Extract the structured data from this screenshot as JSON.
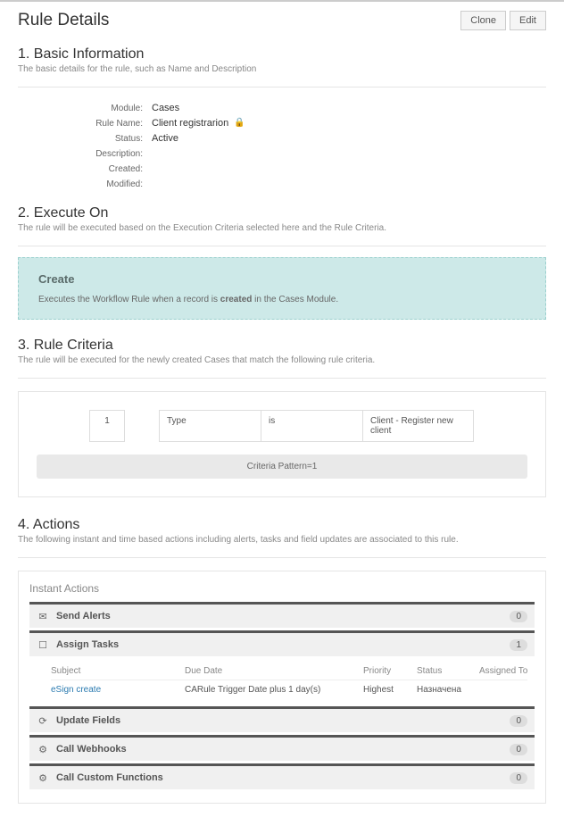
{
  "page": {
    "title": "Rule Details",
    "buttons": {
      "clone": "Clone",
      "edit": "Edit"
    }
  },
  "basic": {
    "heading_num": "1.",
    "heading": "Basic Information",
    "desc": "The basic details for the rule, such as Name and Description",
    "fields": {
      "module_label": "Module:",
      "module_value": "Cases",
      "rulename_label": "Rule Name:",
      "rulename_value": "Client registrarion",
      "status_label": "Status:",
      "status_value": "Active",
      "description_label": "Description:",
      "description_value": "",
      "created_label": "Created:",
      "created_value": " ",
      "modified_label": "Modified:",
      "modified_value": ""
    }
  },
  "execute": {
    "heading_num": "2.",
    "heading": "Execute On",
    "desc": "The rule will be executed based on the Execution Criteria selected here and the Rule Criteria.",
    "box_title": "Create",
    "box_desc_pre": "Executes the Workflow Rule when a record is ",
    "box_desc_bold": "created",
    "box_desc_post": " in the Cases Module."
  },
  "criteria": {
    "heading_num": "3.",
    "heading": "Rule Criteria",
    "desc": "The rule will be executed for the newly created Cases that match the following rule criteria.",
    "row": {
      "num": "1",
      "field": "Type",
      "op": "is",
      "value": "Client - Register new client"
    },
    "pattern": "Criteria Pattern=1"
  },
  "actions": {
    "heading_num": "4.",
    "heading": "Actions",
    "desc": "The following instant and time based actions including alerts, tasks and field updates are associated to this rule.",
    "instant_title": "Instant Actions",
    "groups": {
      "send_alerts": {
        "label": "Send Alerts",
        "count": "0"
      },
      "assign_tasks": {
        "label": "Assign Tasks",
        "count": "1"
      },
      "update_fields": {
        "label": "Update Fields",
        "count": "0"
      },
      "call_webhooks": {
        "label": "Call Webhooks",
        "count": "0"
      },
      "call_custom": {
        "label": "Call Custom Functions",
        "count": "0"
      }
    },
    "task_head": {
      "subject": "Subject",
      "due": "Due Date",
      "priority": "Priority",
      "status": "Status",
      "assigned": "Assigned To"
    },
    "task_row": {
      "subject": "eSign create",
      "due": "CARule Trigger Date plus 1 day(s)",
      "priority": "Highest",
      "status": "Назначена",
      "assigned": " "
    }
  }
}
